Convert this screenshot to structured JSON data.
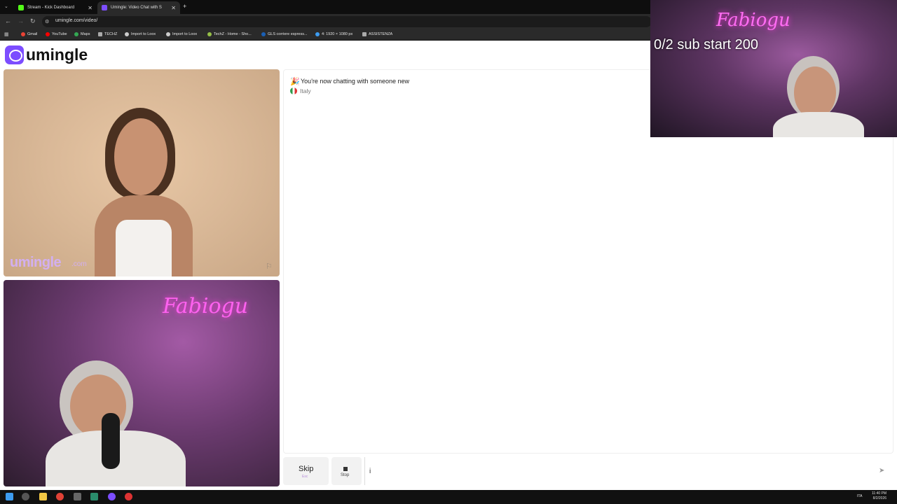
{
  "browser": {
    "tabs": [
      {
        "title": "Stream - Kick Dashboard",
        "active": false,
        "favicon_color": "#53fc18"
      },
      {
        "title": "Umingle: Video Chat with S",
        "active": true,
        "favicon_color": "#7c4dff"
      }
    ],
    "new_tab": "+",
    "url": "umingle.com/video/",
    "bookmarks": [
      {
        "label": "Gmail",
        "color": "#ea4335"
      },
      {
        "label": "YouTube",
        "color": "#ff0000"
      },
      {
        "label": "Maps",
        "color": "#34a853"
      },
      {
        "label": "TECHZ",
        "color": "#aaaaaa"
      },
      {
        "label": "Import to Loox",
        "color": "#cccccc"
      },
      {
        "label": "Import to Loox",
        "color": "#cccccc"
      },
      {
        "label": "TechZ - Home - Sho...",
        "color": "#95bf47"
      },
      {
        "label": "GLS corriere espress...",
        "color": "#1a5fb4"
      },
      {
        "label": "4: 1920 × 1080 px",
        "color": "#3d9cf0"
      },
      {
        "label": "ASSISTENZA",
        "color": "#aaaaaa"
      }
    ]
  },
  "site": {
    "logo_text": "umingle",
    "brand_color": "#7c4dff"
  },
  "video": {
    "watermark": "umingle",
    "watermark_suffix": ".com",
    "neon_sign": "Fabiogu"
  },
  "chat": {
    "status_message": "You're now chatting with someone new",
    "country": "Italy"
  },
  "controls": {
    "skip_label": "Skip",
    "skip_hint": "Esc",
    "stop_label": "Stop",
    "message_value": "i",
    "send_icon": "send-icon"
  },
  "stream_overlay": {
    "text": "0/2 sub start 200",
    "neon": "Fabiogu"
  },
  "taskbar": {
    "time": "11:40 PM",
    "date": "8/2/2026",
    "lang": "ITA"
  }
}
